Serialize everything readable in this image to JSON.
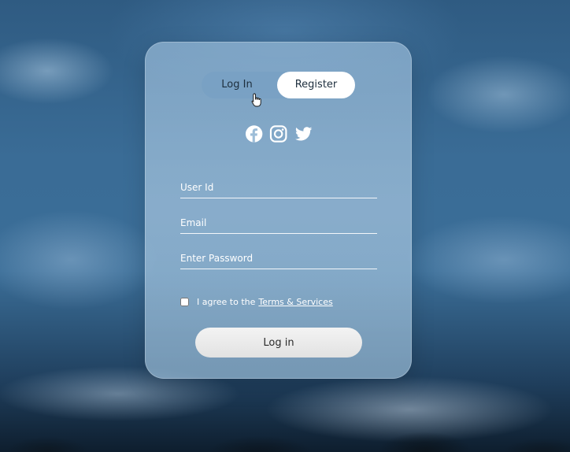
{
  "toggle": {
    "login_label": "Log In",
    "register_label": "Register",
    "active": "Register"
  },
  "socials": [
    "facebook-icon",
    "instagram-icon",
    "twitter-icon"
  ],
  "form": {
    "user_id_placeholder": "User Id",
    "email_placeholder": "Email",
    "password_placeholder": "Enter Password",
    "agree_text": "I agree to the",
    "terms_link": "Terms & Services",
    "agree_checked": false,
    "submit_label": "Log in"
  },
  "colors": {
    "card": "#a8c6e0",
    "toggle_active": "#ffffff",
    "text": "#ffffff",
    "button": "#eeeeee"
  }
}
